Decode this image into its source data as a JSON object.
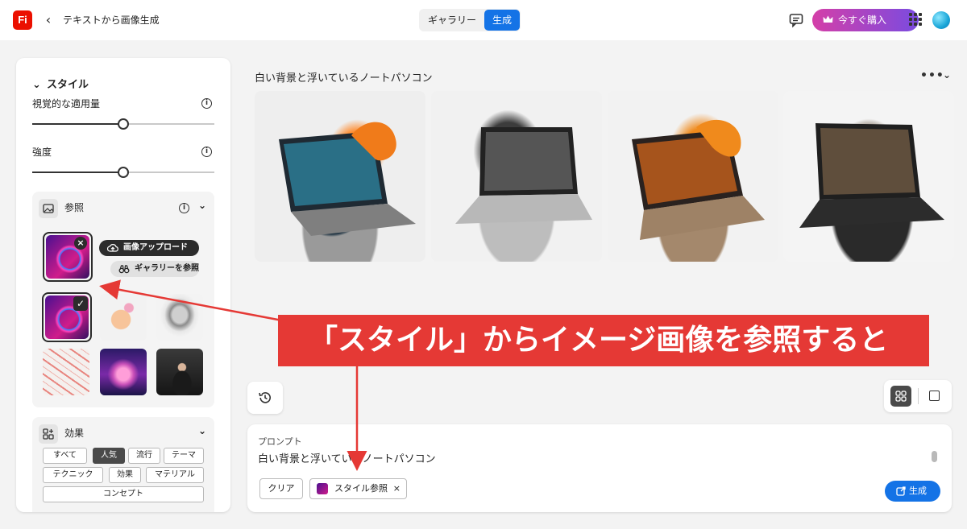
{
  "header": {
    "logo_text": "Fi",
    "back_icon": "chevron-left-icon",
    "title": "テキストから画像生成",
    "tabs": [
      {
        "label": "ギャラリー",
        "active": false
      },
      {
        "label": "生成",
        "active": true
      }
    ],
    "chat_icon": "chat-icon",
    "buy_label": "今すぐ購入",
    "buy_icon": "crown-icon",
    "apps_icon": "apps-grid-icon",
    "accent_color": "#1473e6"
  },
  "style_panel": {
    "title": "スタイル",
    "visual_intensity": {
      "label": "視覚的な適用量",
      "value": 0.5
    },
    "strength": {
      "label": "強度",
      "value": 0.5
    },
    "reference": {
      "title": "参照",
      "upload_label": "画像アップロード",
      "browse_label": "ギャラリーを参照"
    },
    "effects": {
      "title": "効果",
      "filters": [
        "すべて",
        "人気",
        "流行",
        "テーマ",
        "テクニック",
        "効果",
        "マテリアル",
        "コンセプト"
      ],
      "active_filter": "人気"
    }
  },
  "gallery": {
    "title": "白い背景と浮いているノートパソコン",
    "more_label": "•••"
  },
  "prompt_box": {
    "label": "プロンプト",
    "text": "白い背景と浮いているノートパソコン",
    "clear_label": "クリア",
    "style_tag_label": "スタイル参照",
    "style_tag_close": "×",
    "generate_label": "生成"
  },
  "annotation": {
    "text": "「スタイル」からイメージ画像を参照すると",
    "color": "#e53935"
  }
}
